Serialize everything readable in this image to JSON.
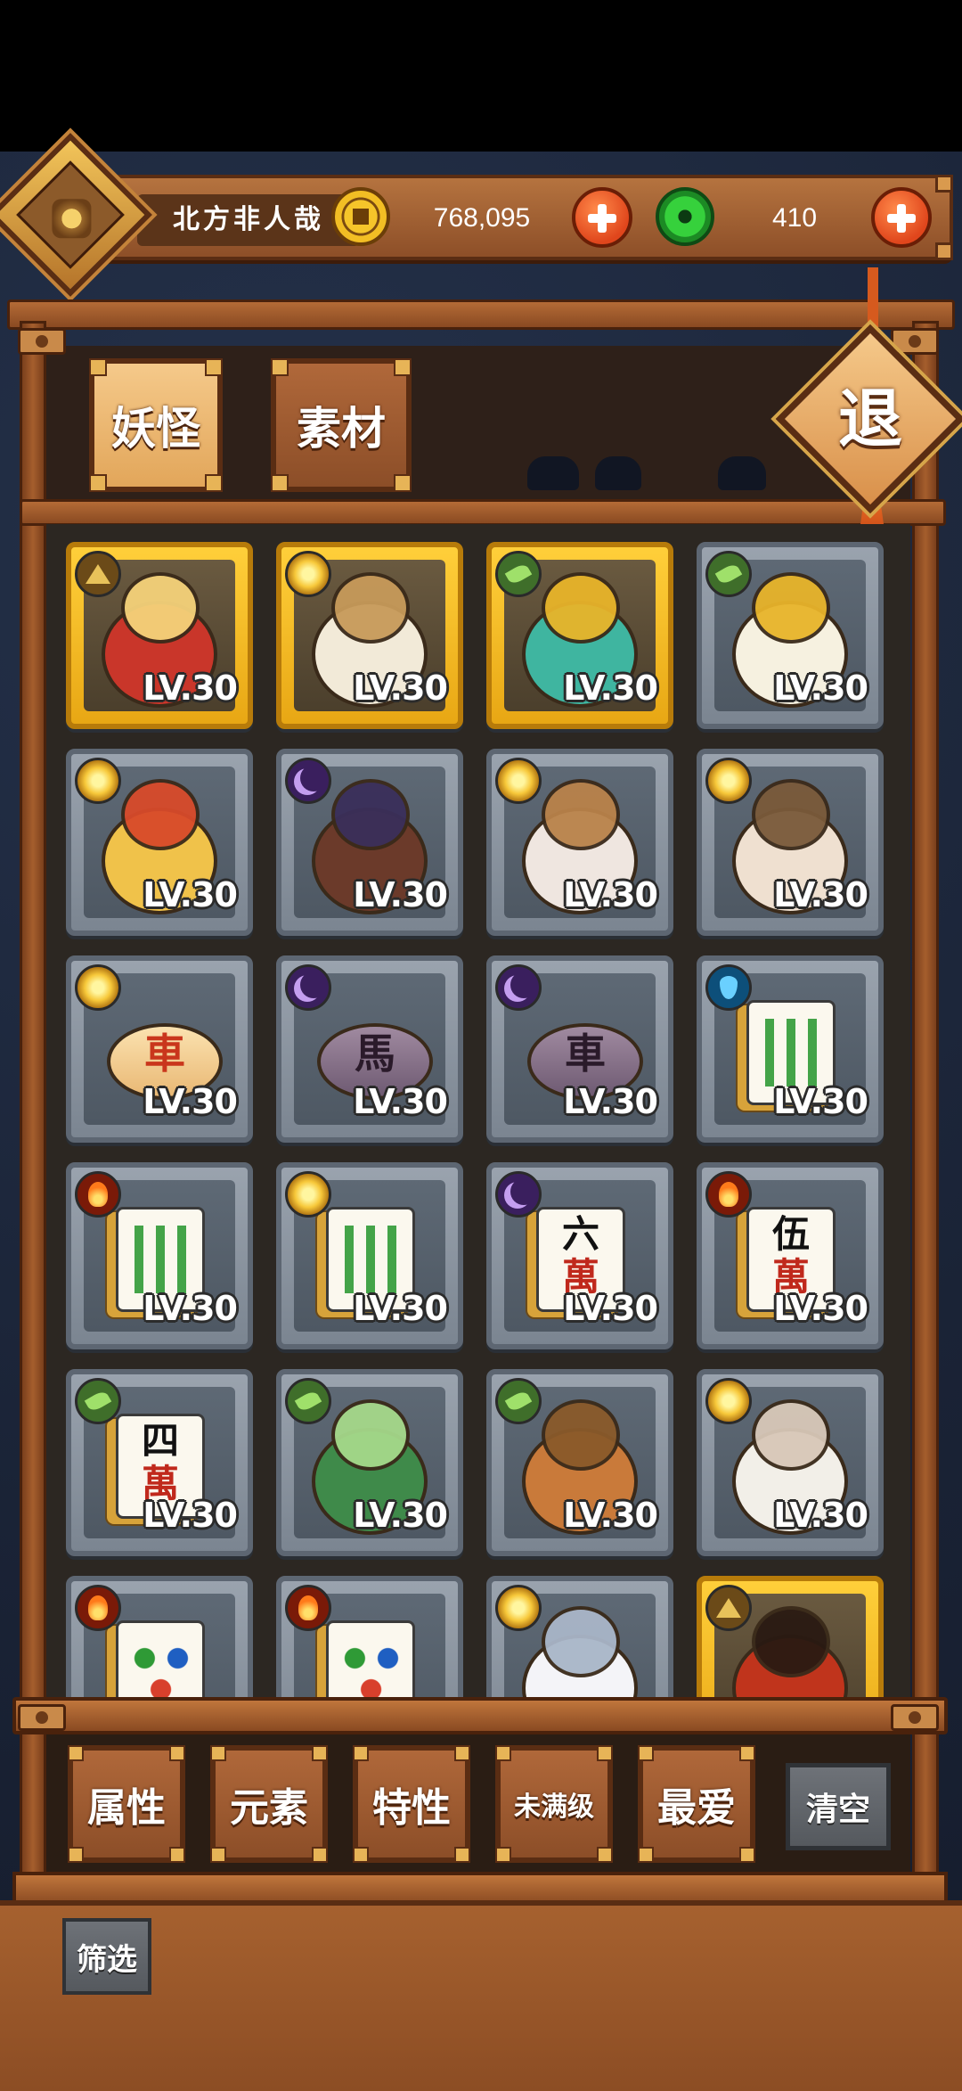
{
  "player": {
    "name": "北方非人哉"
  },
  "currency": {
    "gold": {
      "icon": "gold-coin-icon",
      "amount": "768,095"
    },
    "jade": {
      "icon": "jade-coin-icon",
      "amount": "410"
    }
  },
  "tabs": [
    {
      "label": "妖怪",
      "active": true
    },
    {
      "label": "素材",
      "active": false
    }
  ],
  "exit_label": "退",
  "monsters": [
    {
      "name": "king-monk",
      "element": "earth",
      "level": "LV.30",
      "rare": true
    },
    {
      "name": "scholar",
      "element": "sun",
      "level": "LV.30",
      "rare": true
    },
    {
      "name": "jade-dragon",
      "element": "leaf",
      "level": "LV.30",
      "rare": true
    },
    {
      "name": "white-piece",
      "element": "leaf",
      "level": "LV.30",
      "rare": false
    },
    {
      "name": "crowned-lion",
      "element": "sun",
      "level": "LV.30",
      "rare": false
    },
    {
      "name": "girl-with-gem",
      "element": "moon",
      "level": "LV.30",
      "rare": false
    },
    {
      "name": "deer-boy",
      "element": "sun",
      "level": "LV.30",
      "rare": false
    },
    {
      "name": "hamster",
      "element": "sun",
      "level": "LV.30",
      "rare": false
    },
    {
      "name": "chess-che-red",
      "element": "sun",
      "level": "LV.30",
      "rare": false,
      "glyph": "車"
    },
    {
      "name": "chess-ma-black",
      "element": "moon",
      "level": "LV.30",
      "rare": false,
      "glyph": "馬"
    },
    {
      "name": "chess-che-black",
      "element": "moon",
      "level": "LV.30",
      "rare": false,
      "glyph": "車"
    },
    {
      "name": "mahjong-bamboo",
      "element": "water",
      "level": "LV.30",
      "rare": false
    },
    {
      "name": "mahjong-bamboo",
      "element": "fire",
      "level": "LV.30",
      "rare": false
    },
    {
      "name": "mahjong-bamboo",
      "element": "sun",
      "level": "LV.30",
      "rare": false
    },
    {
      "name": "mahjong-six-wan",
      "element": "moon",
      "level": "LV.30",
      "rare": false,
      "glyph": "六",
      "glyph2": "萬"
    },
    {
      "name": "mahjong-five-wan",
      "element": "fire",
      "level": "LV.30",
      "rare": false,
      "glyph": "伍",
      "glyph2": "萬"
    },
    {
      "name": "mahjong-four-wan",
      "element": "leaf",
      "level": "LV.30",
      "rare": false,
      "glyph": "四",
      "glyph2": "萬"
    },
    {
      "name": "green-serpent",
      "element": "leaf",
      "level": "LV.30",
      "rare": false
    },
    {
      "name": "tree-stump",
      "element": "leaf",
      "level": "LV.30",
      "rare": false
    },
    {
      "name": "white-rabbit",
      "element": "sun",
      "level": "LV.30",
      "rare": false
    },
    {
      "name": "mahjong-dots",
      "element": "fire",
      "level": "",
      "rare": false
    },
    {
      "name": "mahjong-dots",
      "element": "fire",
      "level": "",
      "rare": false
    },
    {
      "name": "white-spirit",
      "element": "sun",
      "level": "",
      "rare": false
    },
    {
      "name": "red-oni",
      "element": "earth",
      "level": "",
      "rare": true
    }
  ],
  "filters": [
    {
      "label": "属性",
      "small": false
    },
    {
      "label": "元素",
      "small": false
    },
    {
      "label": "特性",
      "small": false
    },
    {
      "label": "未满级",
      "small": true
    },
    {
      "label": "最爱",
      "small": false
    }
  ],
  "clear_label": "清空",
  "screen_label": "筛选"
}
